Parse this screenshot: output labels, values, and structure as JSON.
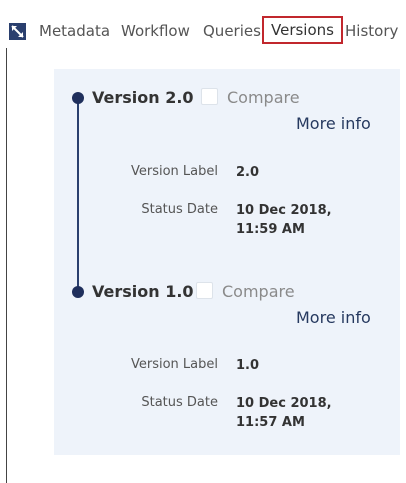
{
  "tabs": [
    {
      "label": "Metadata",
      "selected": false
    },
    {
      "label": "Workflow",
      "selected": false
    },
    {
      "label": "Queries",
      "selected": false
    },
    {
      "label": "Versions",
      "selected": true
    },
    {
      "label": "History",
      "selected": false
    }
  ],
  "versions": [
    {
      "title": "Version 2.0",
      "compare_label": "Compare",
      "more_info": "More info",
      "version_label_caption": "Version Label",
      "version_label_value": "2.0",
      "status_date_caption": "Status Date",
      "status_date_value": "10 Dec 2018, 11:59 AM"
    },
    {
      "title": "Version 1.0",
      "compare_label": "Compare",
      "more_info": "More info",
      "version_label_caption": "Version Label",
      "version_label_value": "1.0",
      "status_date_caption": "Status Date",
      "status_date_value": "10 Dec 2018, 11:57 AM"
    }
  ],
  "colors": {
    "accent": "#2a3f6e",
    "selected_tab_border": "#c1272d",
    "panel_background": "#eef3fa"
  },
  "icons": {
    "expand": "expand-icon"
  }
}
